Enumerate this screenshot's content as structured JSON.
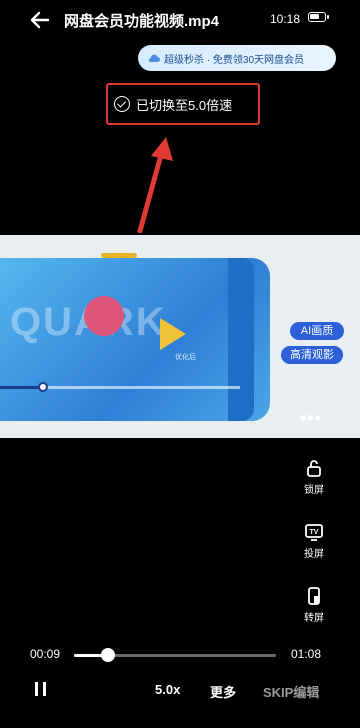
{
  "header": {
    "title": "网盘会员功能视频.mp4",
    "time": "10:18"
  },
  "promo": {
    "text": "超级秒杀 · 免费领30天网盘会员"
  },
  "toast": {
    "text": "已切换至5.0倍速"
  },
  "video_frame": {
    "watermark": "QUARK",
    "caption": "优化后",
    "ai_badge": "AI画质",
    "hd_badge": "高清观影",
    "more_dots": "•••"
  },
  "side_controls": [
    {
      "label": "锁屏",
      "icon": "lock-icon"
    },
    {
      "label": "投屏",
      "icon": "tv-cast-icon"
    },
    {
      "label": "转屏",
      "icon": "rotate-screen-icon"
    }
  ],
  "playback": {
    "current_time": "00:09",
    "total_time": "01:08",
    "progress_fraction": 0.14
  },
  "bottom_bar": {
    "speed": "5.0x",
    "more": "更多",
    "skip": "SKIP编辑"
  },
  "colors": {
    "highlight_red": "#e23a32",
    "accent_blue": "#2c5fd8",
    "promo_text": "#1c4f92"
  }
}
